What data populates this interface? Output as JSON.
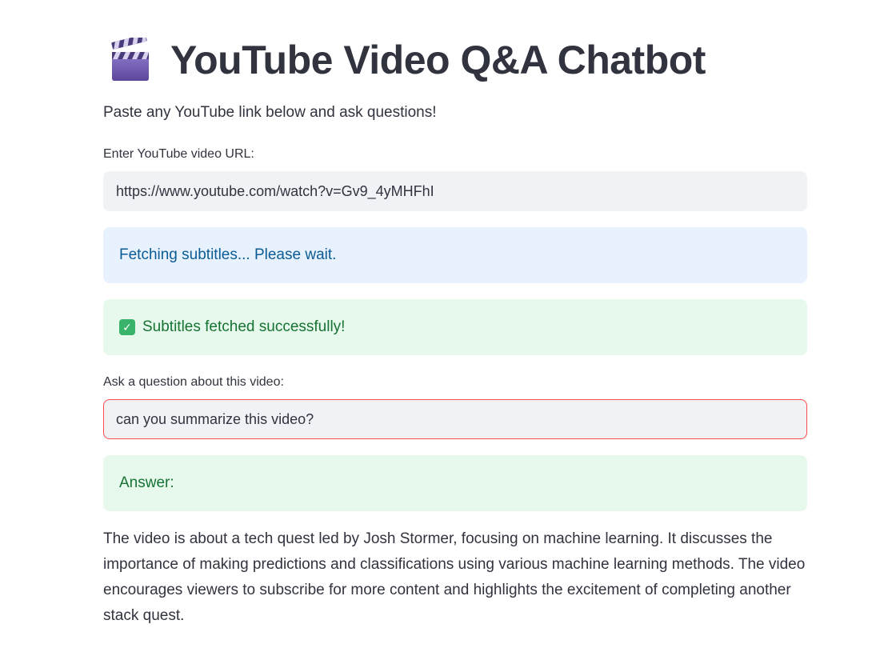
{
  "header": {
    "title": "YouTube Video Q&A Chatbot",
    "icon": "clapperboard-icon",
    "subtitle": "Paste any YouTube link below and ask questions!"
  },
  "url_field": {
    "label": "Enter YouTube video URL:",
    "value": "https://www.youtube.com/watch?v=Gv9_4yMHFhI"
  },
  "alerts": {
    "info": "Fetching subtitles... Please wait.",
    "success_icon": "check-mark-icon",
    "success": "Subtitles fetched successfully!"
  },
  "question_field": {
    "label": "Ask a question about this video:",
    "value": "can you summarize this video?"
  },
  "answer": {
    "heading": "Answer:",
    "text": "The video is about a tech quest led by Josh Stormer, focusing on machine learning. It discusses the importance of making predictions and classifications using various machine learning methods. The video encourages viewers to subscribe for more content and highlights the excitement of completing another stack quest."
  },
  "colors": {
    "text": "#31333f",
    "info_bg": "#e8f2fe",
    "info_text": "#0b5b94",
    "success_bg": "#e6f9ec",
    "success_text": "#177233",
    "input_bg": "#f0f2f6",
    "focus_border": "#ff4b4b"
  }
}
